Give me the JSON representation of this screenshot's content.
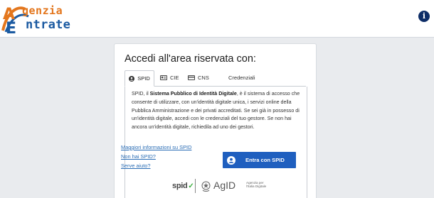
{
  "header": {
    "logo_line1": "genzia",
    "logo_line2": "ntrate",
    "info_glyph": "i"
  },
  "login": {
    "title": "Accedi all'area riservata con:",
    "tabs": [
      {
        "label": "SPID",
        "icon": "user-circle-icon",
        "active": true
      },
      {
        "label": "CIE",
        "icon": "id-card-icon",
        "active": false
      },
      {
        "label": "CNS",
        "icon": "smart-card-icon",
        "active": false
      },
      {
        "label": "Credenziali",
        "icon": "",
        "active": false
      }
    ],
    "description": {
      "before": "SPID, il ",
      "bold": "Sistema Pubblico di Identità Digitale",
      "after": ", è il sistema di accesso che consente di utilizzare, con un'identità digitale unica, i servizi online della Pubblica Amministrazione e dei privati accreditati. Se sei già in possesso di un'identità digitale, accedi con le credenziali del tuo gestore. Se non hai ancora un'identità digitale, richiedila ad uno dei gestori."
    },
    "links": [
      "Maggiori informazioni su SPID",
      "Non hai SPID?",
      "Serve aiuto?"
    ],
    "spid_button_label": "Entra con SPID",
    "footer_logos": {
      "spid": "spid",
      "agid": "AgID",
      "agid_sub_line1": "Agenzia per",
      "agid_sub_line2": "l'Italia Digitale"
    }
  },
  "colors": {
    "brand_orange": "#e3761d",
    "brand_blue": "#1b5aa1",
    "button_blue": "#1f5fbf",
    "link_blue": "#2a6db5",
    "info_navy": "#0d2d67",
    "page_background": "#e9ebee"
  }
}
